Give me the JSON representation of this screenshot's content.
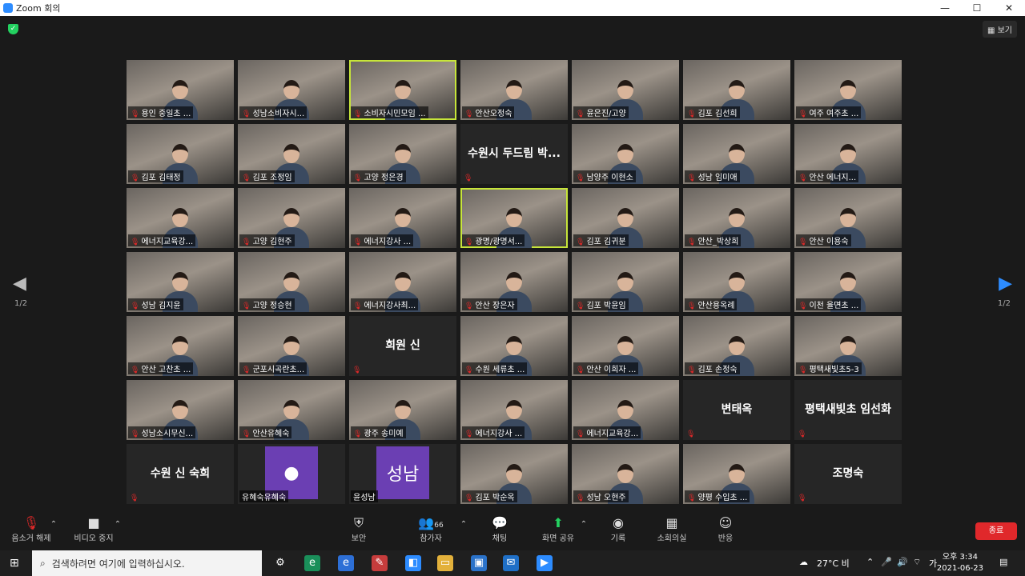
{
  "window": {
    "title": "Zoom 회의",
    "controls": [
      "—",
      "☐",
      "✕"
    ]
  },
  "header": {
    "view_label": "보기"
  },
  "paging": {
    "left": "1/2",
    "right": "1/2"
  },
  "tiles": [
    {
      "type": "video",
      "name": "용인 중일초 ..."
    },
    {
      "type": "video",
      "name": "성남소비자시..."
    },
    {
      "type": "video",
      "name": "소비자시민모임 ...",
      "highlight": true
    },
    {
      "type": "video",
      "name": "안산오정숙"
    },
    {
      "type": "video",
      "name": "윤은진/고양"
    },
    {
      "type": "video",
      "name": "김포 김선희"
    },
    {
      "type": "video",
      "name": "여주 여주초 ..."
    },
    {
      "type": "video",
      "name": "김포 김태정"
    },
    {
      "type": "video",
      "name": "김포 조정임"
    },
    {
      "type": "video",
      "name": "고양 정은경"
    },
    {
      "type": "name",
      "name": "수원시 두드림 박..."
    },
    {
      "type": "video",
      "name": "남양주 이현소"
    },
    {
      "type": "video",
      "name": "성남 임미애"
    },
    {
      "type": "video",
      "name": "안산 에너지..."
    },
    {
      "type": "video",
      "name": "에너지교육강..."
    },
    {
      "type": "video",
      "name": "고양 김현주"
    },
    {
      "type": "video",
      "name": "에너지강사 ..."
    },
    {
      "type": "video",
      "name": "광명/광명서...",
      "highlight": true
    },
    {
      "type": "video",
      "name": "김포 김귀분"
    },
    {
      "type": "video",
      "name": "안산_박상희"
    },
    {
      "type": "video",
      "name": "안산 이용숙"
    },
    {
      "type": "video",
      "name": "성남 김지윤"
    },
    {
      "type": "video",
      "name": "고양 정승현"
    },
    {
      "type": "video",
      "name": "에너지강사최..."
    },
    {
      "type": "video",
      "name": "안산 장은자"
    },
    {
      "type": "video",
      "name": "김포 박윤임"
    },
    {
      "type": "video",
      "name": "안산용옥례"
    },
    {
      "type": "video",
      "name": "이천 율면초 ..."
    },
    {
      "type": "video",
      "name": "안산 고찬초 ..."
    },
    {
      "type": "video",
      "name": "군포시곡란초..."
    },
    {
      "type": "name",
      "name": "희원 신"
    },
    {
      "type": "video",
      "name": "수원 세류초 ..."
    },
    {
      "type": "video",
      "name": "안산 이희자 ..."
    },
    {
      "type": "video",
      "name": "김포 손정숙"
    },
    {
      "type": "video",
      "name": "평택새빛초5-3"
    },
    {
      "type": "video",
      "name": "성남소시무신..."
    },
    {
      "type": "video",
      "name": "안산유혜숙"
    },
    {
      "type": "video",
      "name": "광주 송미예"
    },
    {
      "type": "video",
      "name": "에너지강사 ..."
    },
    {
      "type": "video",
      "name": "에너지교육강..."
    },
    {
      "type": "name",
      "name": "변태옥"
    },
    {
      "type": "name",
      "name": "평택새빛초 임선화"
    },
    {
      "type": "name",
      "name": "수원 신 숙희"
    },
    {
      "type": "avatar",
      "name": "유혜숙유혜숙",
      "avatar_text": "●",
      "color": "#6b3fb3"
    },
    {
      "type": "avatar",
      "name": "윤성남",
      "avatar_text": "성남",
      "color": "#6b3fb3"
    },
    {
      "type": "video",
      "name": "김포 박순옥"
    },
    {
      "type": "video",
      "name": "성남 오현주"
    },
    {
      "type": "video",
      "name": "양평 수입초 ..."
    },
    {
      "type": "name",
      "name": "조명숙"
    }
  ],
  "toolbar": {
    "items": [
      {
        "label": "음소거 해제",
        "icon": "mic-muted-icon"
      },
      {
        "label": "비디오 중지",
        "icon": "camera-icon"
      },
      {
        "label": "보안",
        "icon": "shield-icon"
      },
      {
        "label": "참가자",
        "icon": "participants-icon",
        "count": "66"
      },
      {
        "label": "채팅",
        "icon": "chat-icon"
      },
      {
        "label": "화면 공유",
        "icon": "share-screen-icon"
      },
      {
        "label": "기록",
        "icon": "record-icon"
      },
      {
        "label": "소회의실",
        "icon": "breakout-icon"
      },
      {
        "label": "반응",
        "icon": "reaction-icon"
      }
    ],
    "end_label": "종료"
  },
  "taskbar": {
    "search_placeholder": "검색하려면 여기에 입력하십시오.",
    "weather": "27°C 비",
    "ime": "가",
    "time": "오후 3:34",
    "date": "2021-06-23"
  },
  "colors": {
    "accent": "#2d8cff",
    "end": "#e0282b",
    "share": "#23d160"
  }
}
